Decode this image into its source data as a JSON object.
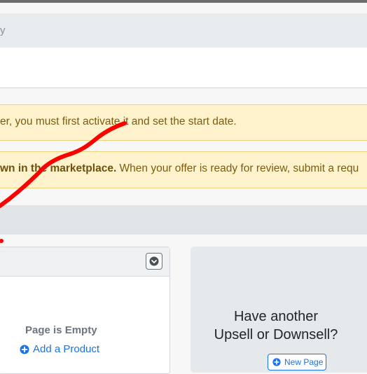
{
  "breadcrumb": {
    "text": "y"
  },
  "alerts": [
    {
      "text": "er, you must first activate it and set the start date."
    },
    {
      "bold": "wn in the marketplace.",
      "text": " When your offer is ready for review, submit a requ"
    }
  ],
  "page_card": {
    "empty_title": "Page is Empty",
    "add_product_label": "Add a Product",
    "add_icon": "plus-circle-icon",
    "toggle_icon": "chevron-down-icon"
  },
  "upsell_card": {
    "title_line1": "Have another",
    "title_line2": "Upsell or Downsell?",
    "new_page_label": "New Page",
    "new_page_icon": "plus-circle-icon"
  },
  "colors": {
    "link": "#1a73e8",
    "alert_bg": "#fff3cd",
    "annotation": "#ff0000"
  }
}
